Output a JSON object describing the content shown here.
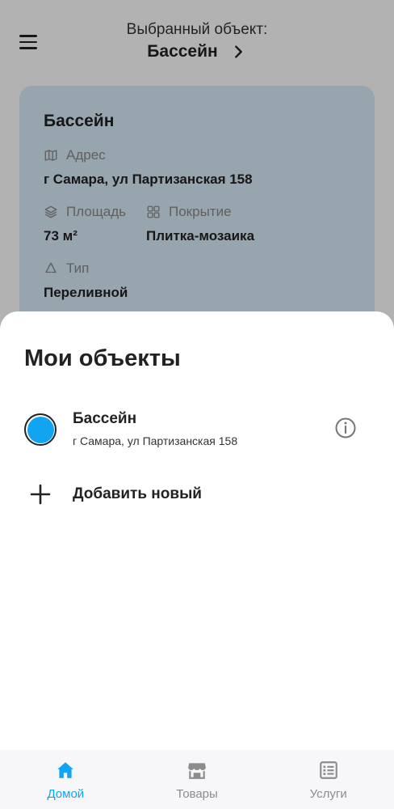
{
  "header": {
    "caption": "Выбранный объект:",
    "selected_name": "Бассейн"
  },
  "card": {
    "title": "Бассейн",
    "address_label": "Адрес",
    "address_value": "г Самара, ул Партизанская 158",
    "area_label": "Площадь",
    "area_value": "73 м²",
    "coating_label": "Покрытие",
    "coating_value": "Плитка-мозаика",
    "type_label": "Тип",
    "type_value": "Переливной"
  },
  "sheet": {
    "title": "Мои объекты",
    "objects": [
      {
        "name": "Бассейн",
        "address": "г Самара, ул Партизанская 158",
        "selected": true
      }
    ],
    "add_label": "Добавить новый"
  },
  "nav": {
    "items": [
      {
        "label": "Домой",
        "icon": "home-icon",
        "active": true
      },
      {
        "label": "Товары",
        "icon": "store-icon",
        "active": false
      },
      {
        "label": "Услуги",
        "icon": "services-list-icon",
        "active": false
      }
    ]
  },
  "colors": {
    "accent": "#11a4f0",
    "card_bg": "#d8ecfb",
    "nav_bg": "#f7f7fa"
  }
}
